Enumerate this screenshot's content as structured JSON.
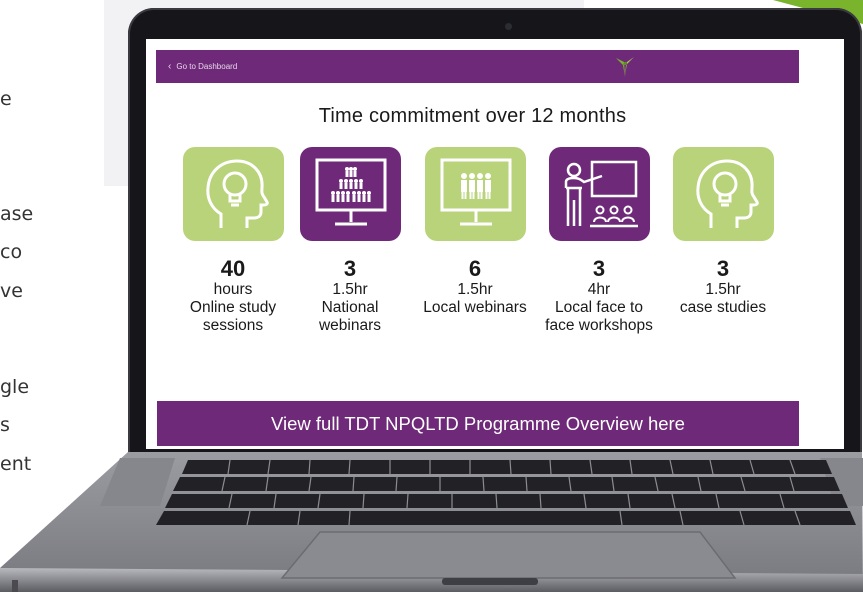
{
  "background": {
    "fragments": [
      "e",
      "ase",
      "co",
      "ve",
      "gle",
      "s",
      "ent"
    ]
  },
  "dashboard": {
    "back_label": "Go to Dashboard",
    "title": "Time commitment over 12 months",
    "cta_label": "View full TDT NPQLTD Programme Overview here",
    "items": [
      {
        "count": "40",
        "unit": "hours",
        "description": "Online study sessions",
        "icon": "head-lightbulb-icon",
        "color": "#b9d37a"
      },
      {
        "count": "3",
        "unit": "1.5hr",
        "description": "National webinars",
        "icon": "monitor-crowd-icon",
        "color": "#6e2a78"
      },
      {
        "count": "6",
        "unit": "1.5hr",
        "description": "Local webinars",
        "icon": "monitor-group-icon",
        "color": "#b9d37a"
      },
      {
        "count": "3",
        "unit": "4hr",
        "description": "Local face to face workshops",
        "icon": "teacher-board-icon",
        "color": "#6e2a78"
      },
      {
        "count": "3",
        "unit": "1.5hr",
        "description": "case studies",
        "icon": "head-lightbulb-icon",
        "color": "#b9d37a"
      }
    ]
  },
  "colors": {
    "brand_purple": "#6e2a78",
    "brand_green": "#b9d37a",
    "accent_green": "#7ab42c"
  }
}
